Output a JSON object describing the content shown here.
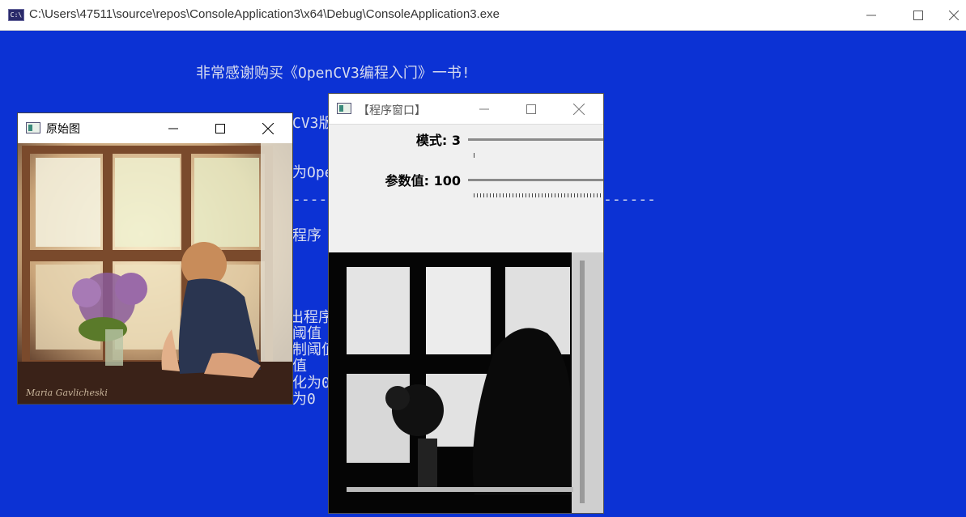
{
  "console": {
    "title": "C:\\Users\\47511\\source\\repos\\ConsoleApplication3\\x64\\Debug\\ConsoleApplication3.exe",
    "icon": "console-app-icon",
    "lines": [
      "非常感谢购买《OpenCV3编程入门》一书!",
      "CV3版",
      "为Open",
      "------",
      "------",
      "程序",
      "出程序",
      "阈值",
      "制阈值",
      "值",
      "化为0",
      "为0"
    ]
  },
  "original_window": {
    "title": "原始图",
    "icon": "opencv-window-icon"
  },
  "program_window": {
    "title": "【程序窗口】",
    "icon": "opencv-window-icon",
    "trackbars": [
      {
        "label": "模式: 3",
        "value": 3
      },
      {
        "label": "参数值: 100",
        "value": 100
      }
    ]
  },
  "colors": {
    "console_bg": "#0c32d4",
    "console_text": "#d8dcef"
  }
}
